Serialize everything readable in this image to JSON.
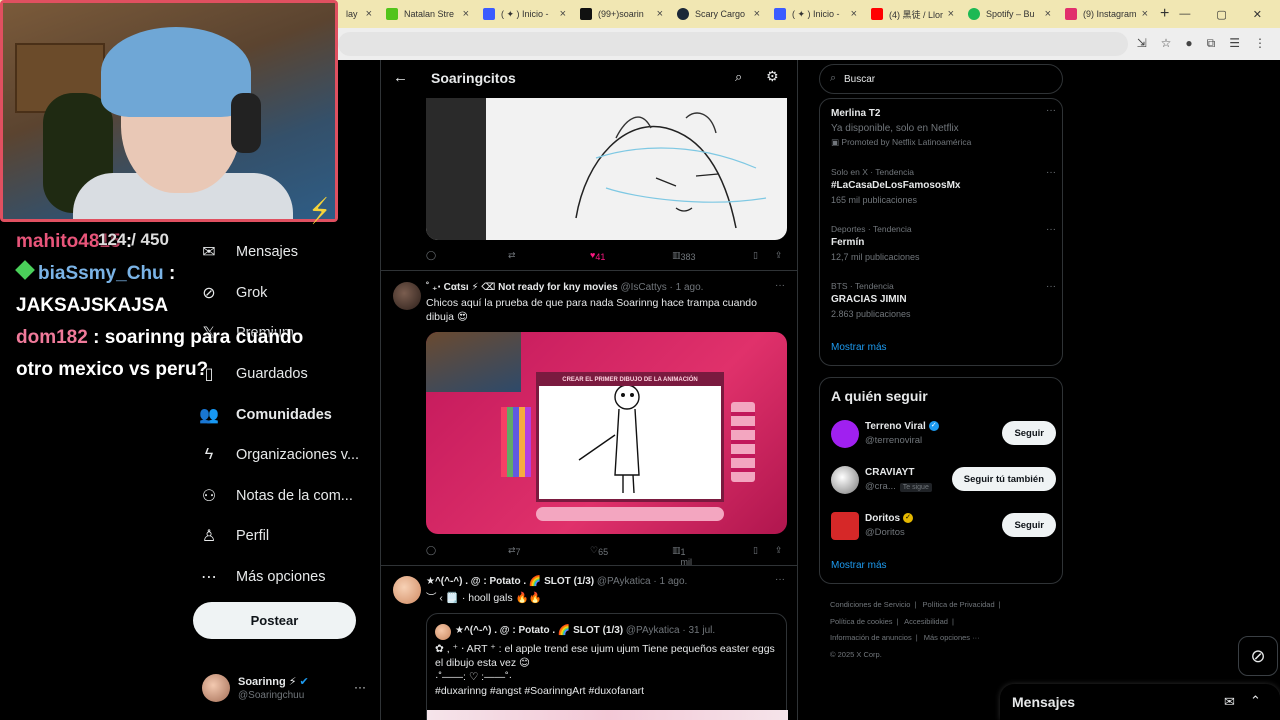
{
  "browser": {
    "tabs": [
      {
        "label": "lay",
        "color": "#8a8a8a"
      },
      {
        "label": "Natalan Stre",
        "color": "#52c41a"
      },
      {
        "label": "( ✦ ) Inicio -",
        "color": "#3b5cff"
      },
      {
        "label": "(99+)soarin",
        "color": "#111111"
      },
      {
        "label": "Scary Cargo",
        "color": "#1b2838"
      },
      {
        "label": "( ✦ ) Inicio -",
        "color": "#3b5cff"
      },
      {
        "label": "(4) 黑徒 / Llor",
        "color": "#ff0000"
      },
      {
        "label": "Spotify – Bu",
        "color": "#1db954"
      },
      {
        "label": "(9) Instagram",
        "color": "#e1306c"
      }
    ],
    "new_tab": "+",
    "win_min": "—",
    "win_max": "▢",
    "win_close": "✕"
  },
  "stream": {
    "counter": "124 / 450",
    "chat": [
      {
        "user": "mahito4815",
        "sep": ":",
        "text": ""
      },
      {
        "user": "biaSsmy_Chu",
        "sep": ":",
        "text": "JAKSAJSKAJSA"
      },
      {
        "user": "dom182",
        "sep": ":",
        "text": "soarinng para cuando otro mexico vs peru?"
      }
    ]
  },
  "nav": {
    "items": [
      {
        "label": "Mensajes",
        "icon": "✉"
      },
      {
        "label": "Grok",
        "icon": "⊘"
      },
      {
        "label": "Premium",
        "icon": "𝕏"
      },
      {
        "label": "Guardados",
        "icon": "▯"
      },
      {
        "label": "Comunidades",
        "icon": "👥"
      },
      {
        "label": "Organizaciones v...",
        "icon": "ϟ"
      },
      {
        "label": "Notas de la com...",
        "icon": "⚇"
      },
      {
        "label": "Perfil",
        "icon": "♙"
      },
      {
        "label": "Más opciones",
        "icon": "⋯"
      }
    ],
    "post_label": "Postear",
    "profile_name": "Soarinng ⚡",
    "profile_handle": "@Soaringchuu",
    "profile_more": "···"
  },
  "feed": {
    "title": "Soaringcitos",
    "back": "←",
    "tweet1_actions": {
      "reply": "",
      "retweet": "",
      "likes": "41",
      "views": "383"
    },
    "tweet2": {
      "name": "˚ ₊‧ Cαtsı ⚡ ⌫ Not ready for kny movies",
      "handle": "@IsCattys",
      "time": "· 1 ago.",
      "text": "Chicos aquí la prueba de que para nada Soarinng hace trampa cuando dibuja 😍",
      "media_banner": "CREAR EL PRIMER DIBUJO DE LA ANIMACIÓN",
      "retweets": "7",
      "likes": "65",
      "views": "1 mil"
    },
    "tweet3": {
      "name": "★^(^-^) . @ : Potato . 🌈 SLOT (1/3)",
      "handle": "@PAykatica",
      "time": "· 1 ago.",
      "text": "︶ ‹ 🗒️ · hooll gals 🔥🔥",
      "quote_name": "★^(^-^) . @ : Potato . 🌈 SLOT (1/3)",
      "quote_handle": "@PAykatica",
      "quote_time": "· 31 jul.",
      "quote_text_1": "✿ , ⁺ ‧ ART ⁺ : el apple trend ese ujum ujum Tiene pequeños easter eggs el dibujo esta vez 😊",
      "quote_text_2": "·˚——: ♡ :——˚·",
      "quote_text_3": "#duxarinng #angst #SoarinngArt #duxofanart"
    }
  },
  "right": {
    "search_placeholder": "Buscar",
    "trends": [
      {
        "context": "",
        "name": "Merlina T2",
        "count": "Ya disponible, solo en Netflix",
        "extra": "Promoted by Netflix Latinoamérica"
      },
      {
        "context": "Solo en X · Tendencia",
        "name": "#LaCasaDeLosFamososMx",
        "count": "165 mil publicaciones"
      },
      {
        "context": "Deportes · Tendencia",
        "name": "Fermín",
        "count": "12,7 mil publicaciones"
      },
      {
        "context": "BTS · Tendencia",
        "name": "GRACIAS JIMIN",
        "count": "2.863 publicaciones"
      }
    ],
    "trends_more": "Mostrar más",
    "follow_title": "A quién seguir",
    "follow": [
      {
        "name": "Terreno Viral",
        "handle": "@terrenoviral",
        "button": "Seguir",
        "tag": "",
        "color": "#a020f0"
      },
      {
        "name": "CRAVIAYT",
        "handle": "@cra...",
        "button": "Seguir tú también",
        "tag": "Te sigue",
        "color": "#dddddd"
      },
      {
        "name": "Doritos",
        "handle": "@Doritos",
        "button": "Seguir",
        "tag": "",
        "color": "#d62828"
      }
    ],
    "follow_more": "Mostrar más",
    "footer": [
      "Condiciones de Servicio",
      "|",
      "Política de Privacidad",
      "|",
      "Política de cookies",
      "|",
      "Accesibilidad",
      "|",
      "Información de anuncios",
      "|",
      "Más opciones ···",
      "© 2025 X Corp."
    ],
    "messages_label": "Mensajes"
  }
}
